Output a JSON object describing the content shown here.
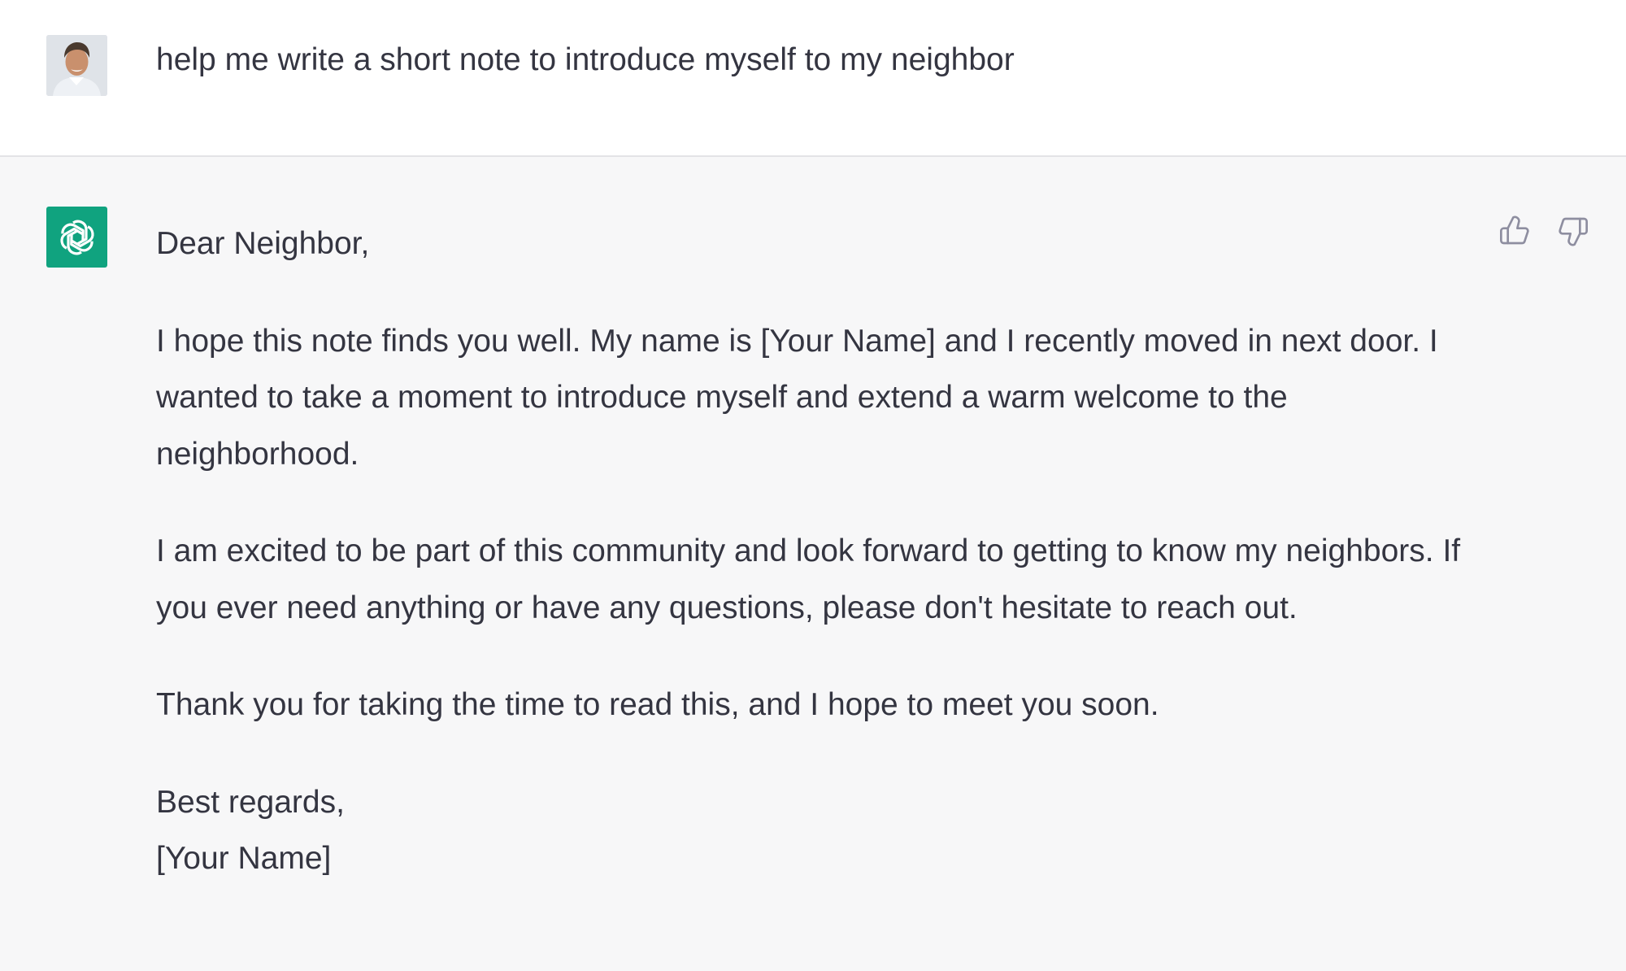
{
  "colors": {
    "page_bg": "#f7f7f8",
    "user_bg": "#ffffff",
    "text": "#343541",
    "bot_avatar_bg": "#10a37f",
    "icon": "#8e8ea0"
  },
  "user_message": {
    "avatar_icon": "user-avatar-photo",
    "text": "help me write a short note to introduce myself to my neighbor"
  },
  "assistant_message": {
    "avatar_icon": "openai-logo-icon",
    "salutation": "Dear Neighbor,",
    "paragraph_1": "I hope this note finds you well. My name is [Your Name] and I recently moved in next door. I wanted to take a moment to introduce myself and extend a warm welcome to the neighborhood.",
    "paragraph_2": "I am excited to be part of this community and look forward to getting to know my neighbors. If you ever need anything or have any questions, please don't hesitate to reach out.",
    "paragraph_3": "Thank you for taking the time to read this, and I hope to meet you soon.",
    "closing_line_1": "Best regards,",
    "closing_line_2": "[Your Name]"
  },
  "actions": {
    "thumbs_up_icon": "thumbs-up-icon",
    "thumbs_down_icon": "thumbs-down-icon"
  }
}
